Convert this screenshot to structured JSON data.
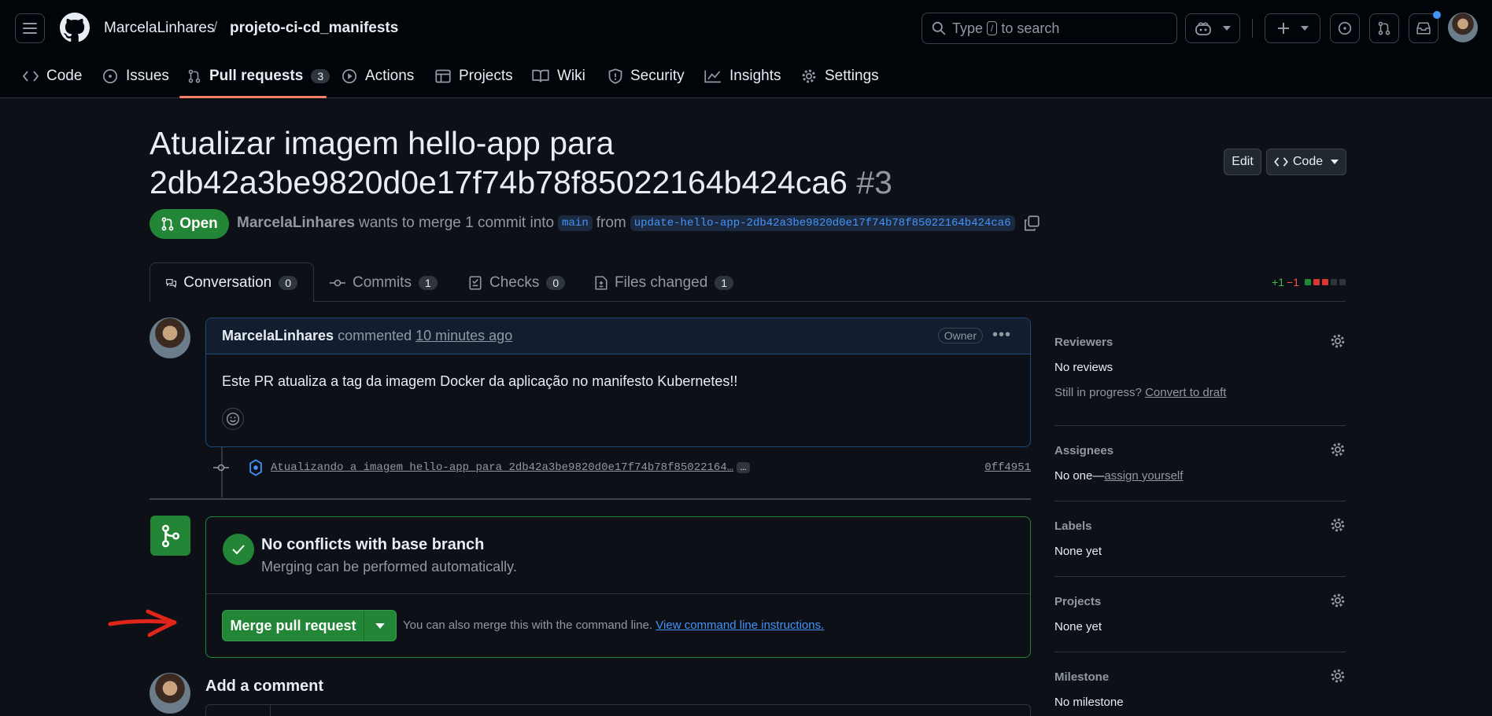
{
  "header": {
    "owner": "MarcelaLinhares",
    "separator": "/",
    "repo": "projeto-ci-cd_manifests",
    "search_pre": "Type",
    "search_key": "/",
    "search_post": "to search"
  },
  "repo_nav": [
    {
      "label": "Code",
      "icon": "code-icon"
    },
    {
      "label": "Issues",
      "icon": "issue-icon"
    },
    {
      "label": "Pull requests",
      "icon": "pull-request-icon",
      "count": "3"
    },
    {
      "label": "Actions",
      "icon": "play-icon"
    },
    {
      "label": "Projects",
      "icon": "table-icon"
    },
    {
      "label": "Wiki",
      "icon": "book-icon"
    },
    {
      "label": "Security",
      "icon": "shield-icon"
    },
    {
      "label": "Insights",
      "icon": "graph-icon"
    },
    {
      "label": "Settings",
      "icon": "gear-icon"
    }
  ],
  "pr": {
    "title_line1": "Atualizar imagem hello-app para",
    "title_line2": "2db42a3be9820d0e17f74b78f85022164b424ca6",
    "number": "#3",
    "edit_label": "Edit",
    "code_label": "Code",
    "state": "Open",
    "author": "MarcelaLinhares",
    "merge_text": "wants to merge 1 commit into",
    "base_branch": "main",
    "from_text": "from",
    "head_branch": "update-hello-app-2db42a3be9820d0e17f74b78f85022164b424ca6"
  },
  "pr_tabs": [
    {
      "label": "Conversation",
      "count": "0"
    },
    {
      "label": "Commits",
      "count": "1"
    },
    {
      "label": "Checks",
      "count": "0"
    },
    {
      "label": "Files changed",
      "count": "1"
    }
  ],
  "diffstat": {
    "additions": "+1",
    "deletions": "−1",
    "colors": [
      "#238636",
      "#da3633",
      "#da3633",
      "#2f353d",
      "#2f353d"
    ]
  },
  "comment": {
    "author": "MarcelaLinhares",
    "action": "commented",
    "time": "10 minutes ago",
    "badge": "Owner",
    "body": "Este PR atualiza a tag da imagem Docker da aplicação no manifesto Kubernetes!!"
  },
  "commit": {
    "message": "Atualizando a imagem hello-app para 2db42a3be9820d0e17f74b78f85022164…",
    "ellipsis": "…",
    "sha": "0ff4951"
  },
  "merge": {
    "title": "No conflicts with base branch",
    "subtitle": "Merging can be performed automatically.",
    "button": "Merge pull request",
    "note": "You can also merge this with the command line.",
    "link": "View command line instructions."
  },
  "add_comment": {
    "title": "Add a comment"
  },
  "sidebar": {
    "reviewers": {
      "heading": "Reviewers",
      "value": "No reviews",
      "draft_prefix": "Still in progress?",
      "draft_link": "Convert to draft"
    },
    "assignees": {
      "heading": "Assignees",
      "value_prefix": "No one—",
      "link": "assign yourself"
    },
    "labels": {
      "heading": "Labels",
      "value": "None yet"
    },
    "projects": {
      "heading": "Projects",
      "value": "None yet"
    },
    "milestone": {
      "heading": "Milestone",
      "value": "No milestone"
    }
  }
}
